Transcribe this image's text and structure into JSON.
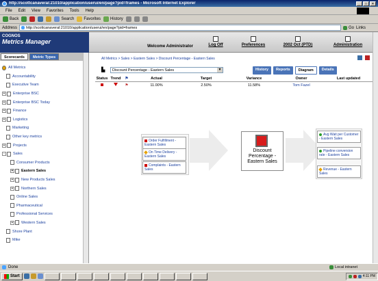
{
  "window": {
    "title": "http://scottcanaveral:21010/application/userui/en/page?pid=frames - Microsoft Internet Explorer",
    "controls": [
      "_",
      "□",
      "×"
    ]
  },
  "menu": [
    "File",
    "Edit",
    "View",
    "Favorites",
    "Tools",
    "Help"
  ],
  "toolbar": {
    "back": "Back",
    "search": "Search",
    "favorites": "Favorites",
    "history": "History"
  },
  "address": {
    "label": "Address",
    "url": "http://scottcanaveral:21010/application/userui/en/page?pid=frames",
    "go": "Go",
    "links": "Links"
  },
  "header": {
    "brand_top": "COGNOS",
    "brand_product": "Metrics Manager",
    "welcome": "Welcome Administrator",
    "links": [
      "Log Off",
      "Preferences",
      "2002 Oct (PTD)",
      "Administration"
    ]
  },
  "left": {
    "tabs": [
      "Scorecards",
      "Metric Types"
    ],
    "tree": [
      {
        "label": "All Metrics",
        "level": 0,
        "exp": ""
      },
      {
        "label": "Accountability",
        "level": 1,
        "exp": ""
      },
      {
        "label": "Executive Team",
        "level": 1,
        "exp": ""
      },
      {
        "label": "Enterprise BSC",
        "level": 0,
        "exp": "+"
      },
      {
        "label": "Enterprise BSC Today",
        "level": 0,
        "exp": "+"
      },
      {
        "label": "Finance",
        "level": 0,
        "exp": "+"
      },
      {
        "label": "Logistics",
        "level": 0,
        "exp": "+"
      },
      {
        "label": "Marketing",
        "level": 1,
        "exp": ""
      },
      {
        "label": "Other key metrics",
        "level": 1,
        "exp": ""
      },
      {
        "label": "Projects",
        "level": 0,
        "exp": "+"
      },
      {
        "label": "Sales",
        "level": 0,
        "exp": "-"
      },
      {
        "label": "Consumer Products",
        "level": 2,
        "exp": ""
      },
      {
        "label": "Eastern Sales",
        "level": 2,
        "exp": "+",
        "bold": true
      },
      {
        "label": "New Products Sales",
        "level": 2,
        "exp": "+"
      },
      {
        "label": "Northern Sales",
        "level": 2,
        "exp": "+"
      },
      {
        "label": "Online Sales",
        "level": 2,
        "exp": ""
      },
      {
        "label": "Pharmaceutical",
        "level": 2,
        "exp": ""
      },
      {
        "label": "Professional Services",
        "level": 2,
        "exp": ""
      },
      {
        "label": "Western Sales",
        "level": 2,
        "exp": "+"
      },
      {
        "label": "Shore Plant",
        "level": 1,
        "exp": ""
      },
      {
        "label": "Mike",
        "level": 1,
        "exp": ""
      }
    ]
  },
  "main": {
    "breadcrumb": "All Metrics > Sales > Eastern Sales > Discount Percentage - Eastern Sales",
    "selected_metric": "Discount Percentage - Eastern Sales",
    "view_tabs": [
      "History",
      "Reports",
      "Diagram",
      "Details"
    ],
    "active_tab": "Diagram",
    "columns": [
      "Status",
      "Trend",
      "",
      "Actual",
      "Target",
      "Variance",
      "Owner",
      "Last updated"
    ],
    "row": {
      "actual": "11.00%",
      "target": "2.50%",
      "variance": "11.58%",
      "owner": "Tom Fazel",
      "updated": ""
    },
    "diagram": {
      "center": "Discount Percentage - Eastern Sales",
      "left": [
        "Order Fulfillment - Eastern Sales",
        "On Time Delivery - Eastern Sales",
        "Complaints - Eastern Sales"
      ],
      "right": [
        "Avg Wait per Customer - Eastern Sales",
        "Pipeline conversion rate - Eastern Sales",
        "Revenue - Eastern Sales"
      ]
    }
  },
  "status": {
    "left": "Done",
    "zone": "Local intranet"
  },
  "taskbar": {
    "start": "Start",
    "clock": "4:11 PM"
  },
  "colors": {
    "brand": "#1f3a78",
    "accent": "#4a74b8",
    "status_bad": "#cc0000"
  }
}
